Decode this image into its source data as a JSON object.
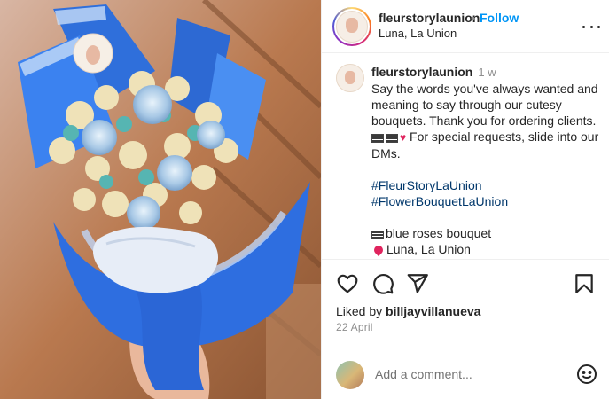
{
  "header": {
    "username": "fleurstorylaunion",
    "separator": "•",
    "follow_label": "Follow",
    "location": "Luna, La Union"
  },
  "caption": {
    "username": "fleurstorylaunion",
    "time": "1 w",
    "text": "Say the words you've always wanted and meaning to say through our cutesy bouquets. Thank you for ordering clients.",
    "text_2": "For special requests, slide into our DMs.",
    "hashtags": [
      "#FleurStoryLaUnion",
      "#FlowerBouquetLaUnion"
    ],
    "product": "blue roses bouquet",
    "product_location": "Luna, La Union"
  },
  "actions": {
    "like_icon": "heart-icon",
    "comment_icon": "comment-icon",
    "share_icon": "paper-plane-icon",
    "save_icon": "bookmark-icon",
    "liked_by_prefix": "Liked by",
    "liked_by_user": "billjayvillanueva",
    "date": "22 April"
  },
  "comment": {
    "placeholder": "Add a comment...",
    "emoji_icon": "smiley-icon"
  },
  "colors": {
    "follow": "#0095f6",
    "hashtag": "#00376b",
    "muted": "#8e8e8e",
    "text": "#262626"
  }
}
